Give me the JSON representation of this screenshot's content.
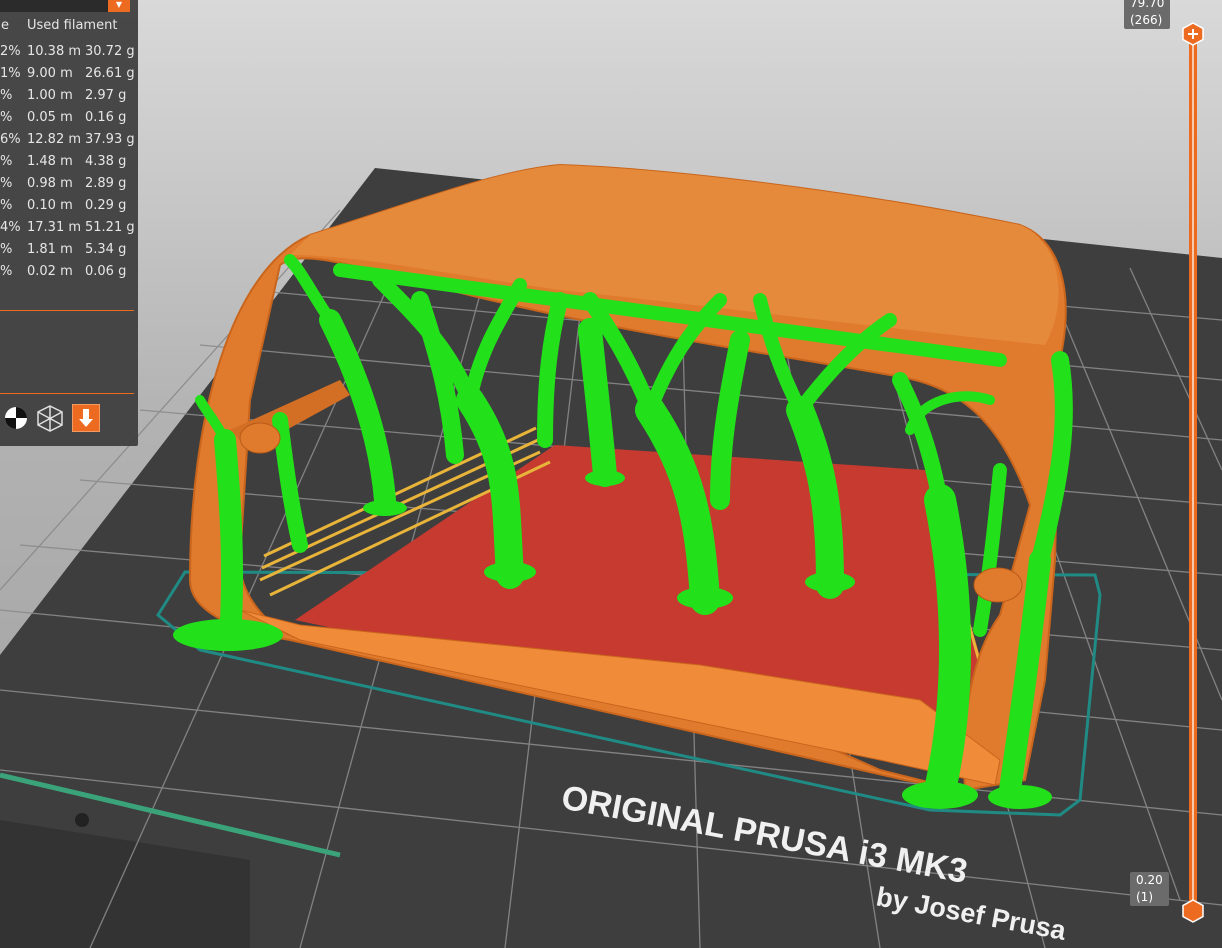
{
  "legend": {
    "header_partial": "e",
    "used_filament_label": "Used filament",
    "rows": [
      {
        "percent": "2%",
        "length": "10.38 m",
        "weight": "30.72 g"
      },
      {
        "percent": "1%",
        "length": "9.00 m",
        "weight": "26.61 g"
      },
      {
        "percent": "%",
        "length": "1.00 m",
        "weight": "2.97 g"
      },
      {
        "percent": "%",
        "length": "0.05 m",
        "weight": "0.16 g"
      },
      {
        "percent": "6%",
        "length": "12.82 m",
        "weight": "37.93 g"
      },
      {
        "percent": "%",
        "length": "1.48 m",
        "weight": "4.38 g"
      },
      {
        "percent": "%",
        "length": "0.98 m",
        "weight": "2.89 g"
      },
      {
        "percent": "%",
        "length": "0.10 m",
        "weight": "0.29 g"
      },
      {
        "percent": "4%",
        "length": "17.31 m",
        "weight": "51.21 g"
      },
      {
        "percent": "%",
        "length": "1.81 m",
        "weight": "5.34 g"
      },
      {
        "percent": "%",
        "length": "0.02 m",
        "weight": "0.06 g"
      }
    ]
  },
  "view_buttons": [
    "center-of-gravity-icon",
    "wireframe-cube-icon",
    "export-arrow-icon"
  ],
  "layer_slider": {
    "top_height": "79.70",
    "top_layer": "(266)",
    "bottom_height": "0.20",
    "bottom_layer": "(1)"
  },
  "bed": {
    "brand_line1": "ORIGINAL PRUSA i3  MK3",
    "brand_line2": "by Josef Prusa"
  },
  "colors": {
    "accent": "#ed6b21",
    "perimeter": "#e07a2d",
    "support": "#22e01a",
    "infill": "#c83a2e",
    "bed": "#3c3c3c",
    "skirt": "#1f8b84"
  }
}
